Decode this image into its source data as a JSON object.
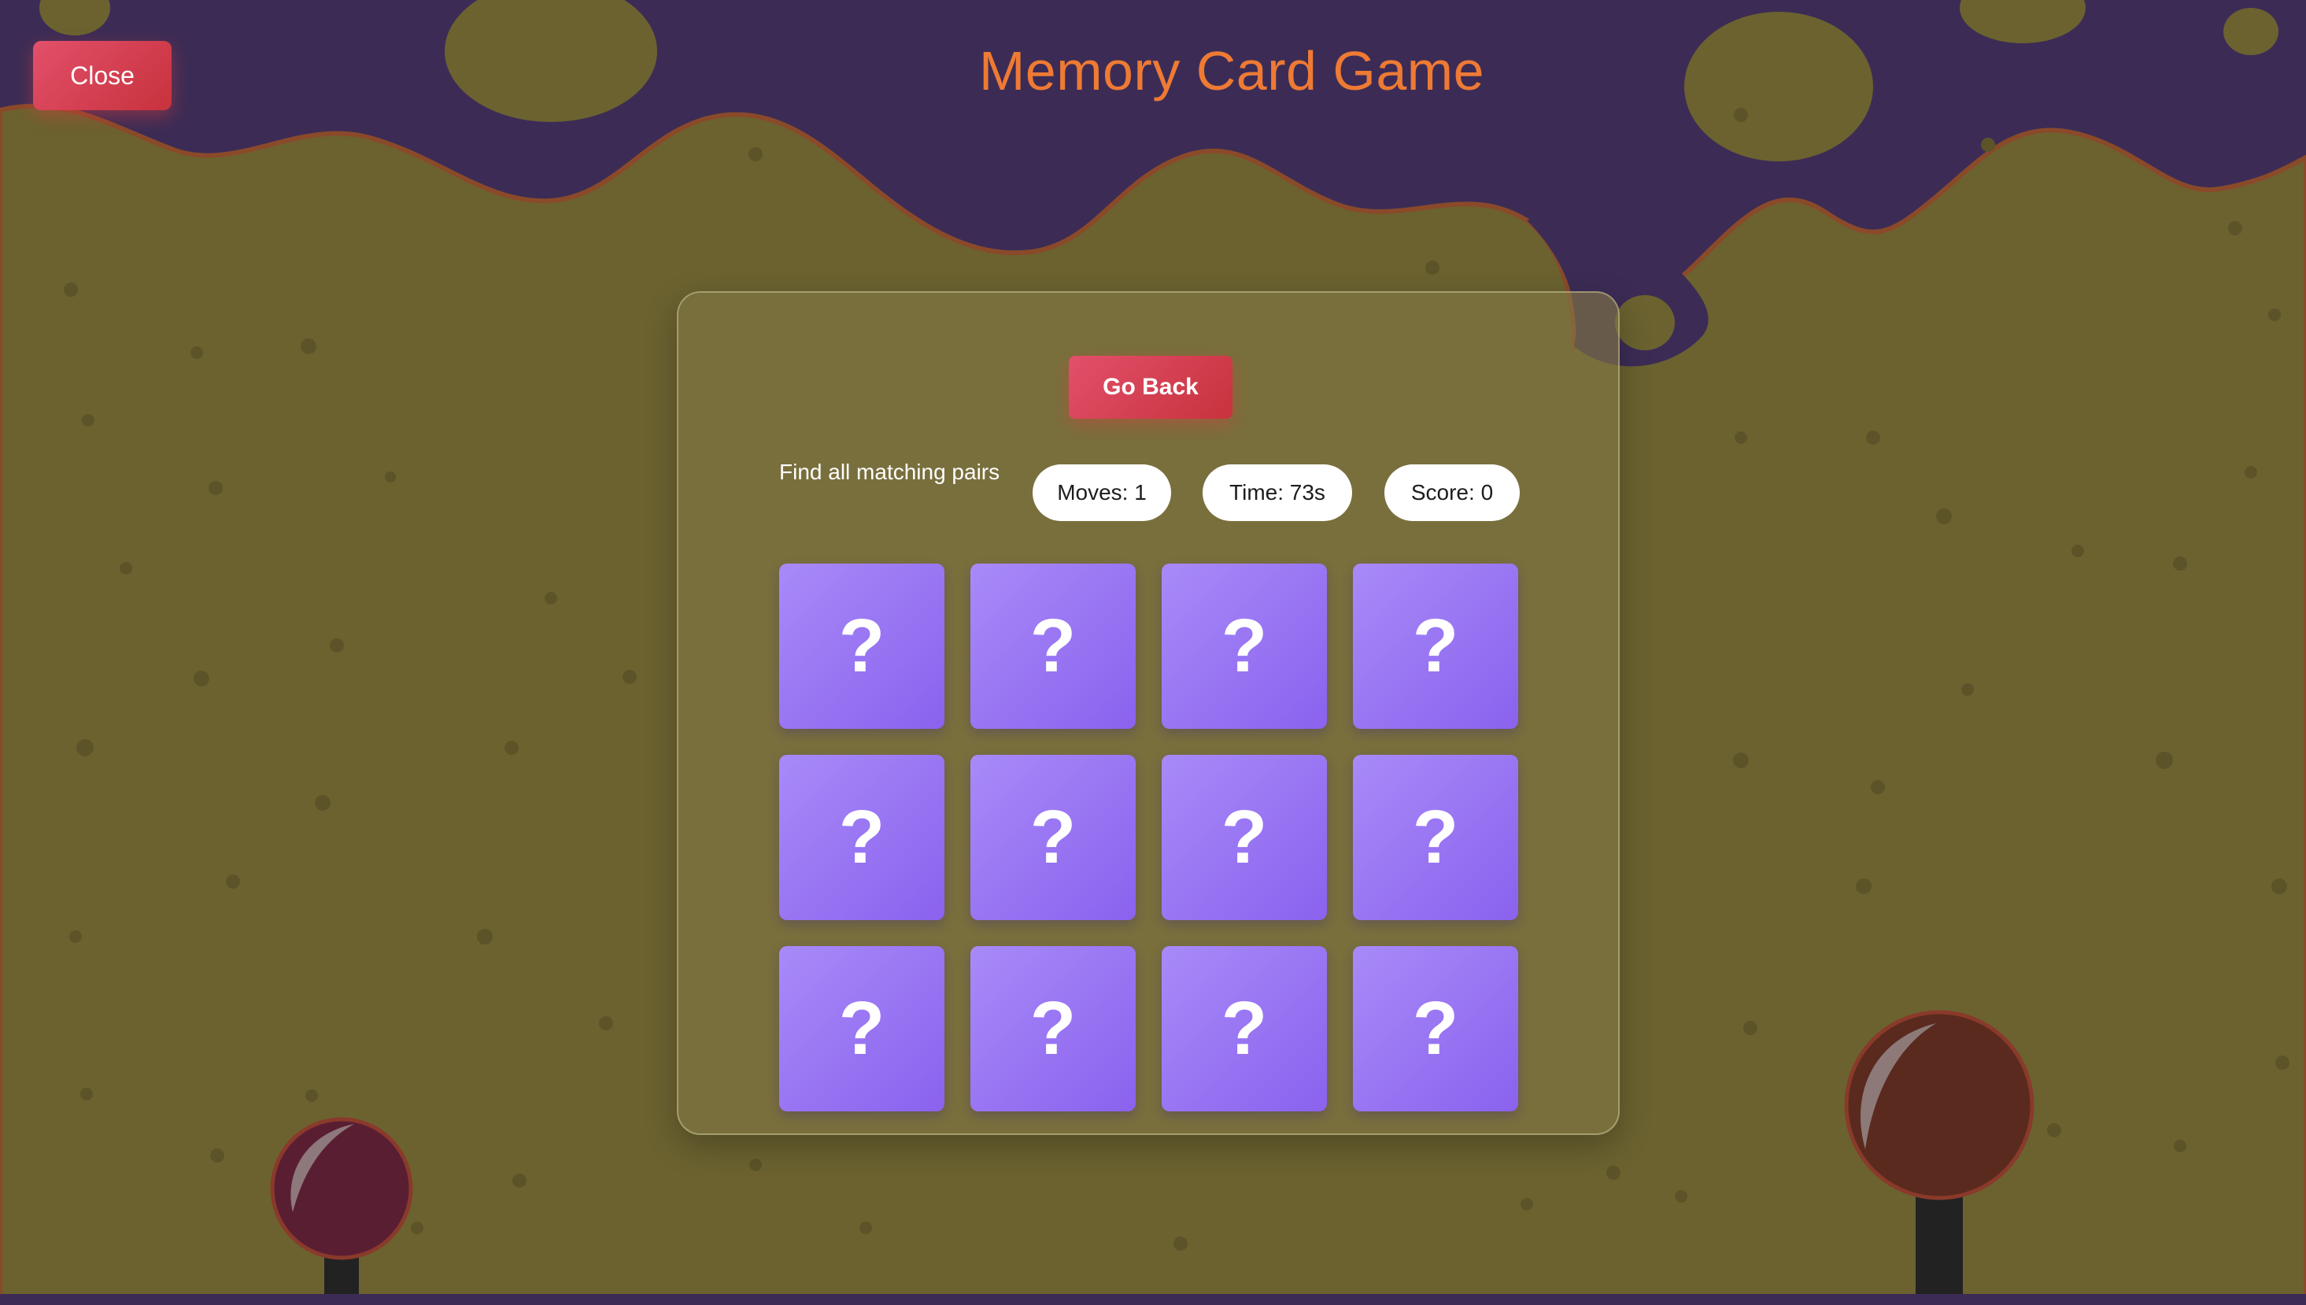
{
  "header": {
    "close_label": "Close",
    "title": "Memory Card Game"
  },
  "game": {
    "go_back_label": "Go Back",
    "instructions": "Find all matching pairs",
    "stats": {
      "moves": "Moves: 1",
      "time": "Time: 73s",
      "score": "Score: 0"
    },
    "cards": [
      {
        "face": "?"
      },
      {
        "face": "?"
      },
      {
        "face": "?"
      },
      {
        "face": "?"
      },
      {
        "face": "?"
      },
      {
        "face": "?"
      },
      {
        "face": "?"
      },
      {
        "face": "?"
      },
      {
        "face": "?"
      },
      {
        "face": "?"
      },
      {
        "face": "?"
      },
      {
        "face": "?"
      }
    ]
  },
  "colors": {
    "sky": "#3c2c55",
    "ground": "#6b6230",
    "accent_title": "#ee7a34",
    "button_red": "#d63b4c",
    "card_purple": "#9775f4"
  }
}
